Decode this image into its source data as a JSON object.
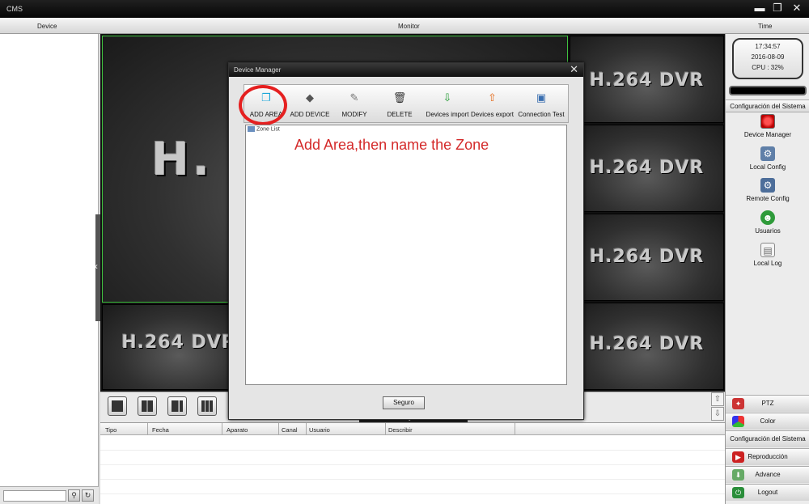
{
  "window": {
    "title": "CMS"
  },
  "header": {
    "device": "Device",
    "monitor": "Monitor",
    "time": "Time"
  },
  "video": {
    "channel_text": "H.264 DVR",
    "big_text": "H."
  },
  "clock": {
    "time": "17:34:57",
    "date": "2016-08-09",
    "cpu": "CPU : 32%"
  },
  "right_panel": {
    "section_title": "Configuración del Sistema",
    "items": [
      {
        "label": "Device Manager",
        "icon": "device-manager-icon"
      },
      {
        "label": "Local Config",
        "icon": "local-config-icon"
      },
      {
        "label": "Remote Config",
        "icon": "remote-config-icon"
      },
      {
        "label": "Usuarios",
        "icon": "users-icon"
      },
      {
        "label": "Local Log",
        "icon": "log-icon"
      }
    ],
    "bottom": [
      {
        "label": "PTZ",
        "icon": "ptz-icon"
      },
      {
        "label": "Color",
        "icon": "color-icon"
      },
      {
        "label": "Configuración del Sistema",
        "icon": "settings-icon"
      },
      {
        "label": "Reproducción",
        "icon": "playback-icon"
      },
      {
        "label": "Advance",
        "icon": "advance-icon"
      },
      {
        "label": "Logout",
        "icon": "logout-icon"
      }
    ]
  },
  "log_table": {
    "columns": [
      "Tipo",
      "Fecha",
      "Aparato",
      "Canal",
      "Usuario",
      "Describir"
    ]
  },
  "dialog": {
    "title": "Device Manager",
    "toolbar": [
      {
        "label": "ADD AREA",
        "icon": "add-area-icon"
      },
      {
        "label": "ADD DEVICE",
        "icon": "add-device-icon"
      },
      {
        "label": "MODIFY",
        "icon": "modify-icon"
      },
      {
        "label": "DELETE",
        "icon": "trash-icon"
      },
      {
        "label": "Devices import",
        "icon": "import-icon"
      },
      {
        "label": "Devices export",
        "icon": "export-icon"
      },
      {
        "label": "Connection Test",
        "icon": "connection-test-icon"
      }
    ],
    "tree_root": "Zone List",
    "annotation": "Add Area,then name the Zone",
    "ok_label": "Seguro"
  },
  "colors": {
    "annotation": "#d42a2a",
    "active_border": "#3fc13f"
  }
}
